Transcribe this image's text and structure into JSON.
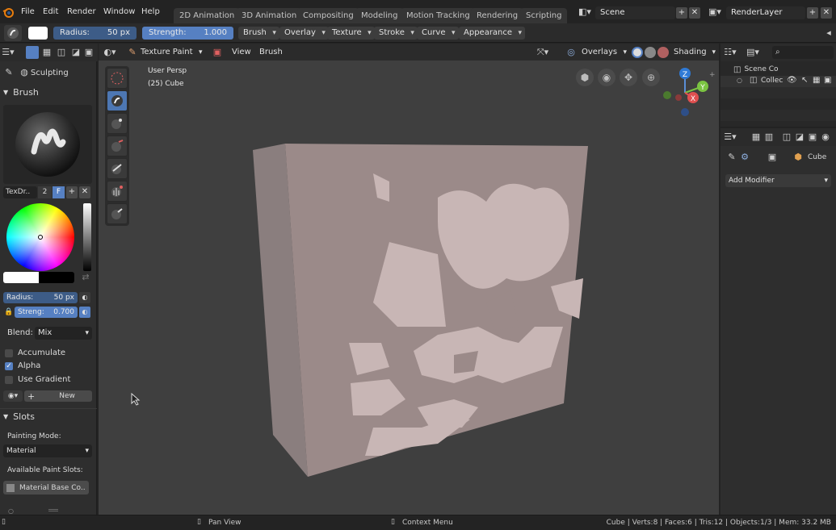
{
  "menubar": {
    "menus": [
      "File",
      "Edit",
      "Render",
      "Window",
      "Help"
    ],
    "workspaces": [
      "2D Animation",
      "3D Animation",
      "Compositing",
      "Modeling",
      "Motion Tracking",
      "Rendering",
      "Scripting"
    ],
    "scene_name": "Scene",
    "render_layer": "RenderLayer"
  },
  "toolheader": {
    "radius_label": "Radius:",
    "radius_value": "50 px",
    "strength_label": "Strength:",
    "strength_value": "1.000",
    "menus": [
      "Brush",
      "Overlay",
      "Texture",
      "Stroke",
      "Curve",
      "Appearance"
    ]
  },
  "left_header": {
    "mode_label": "Sculpting"
  },
  "brush_panel": {
    "title": "Brush",
    "brush_name": "TexDr..",
    "user_count": "2",
    "fake_user": "F",
    "radius_label": "Radius:",
    "radius_value": "50 px",
    "strength_label": "Streng:",
    "strength_value": "0.700",
    "blend_label": "Blend:",
    "blend_value": "Mix",
    "accumulate_label": "Accumulate",
    "alpha_label": "Alpha",
    "use_gradient_label": "Use Gradient",
    "new_label": "New"
  },
  "slots_panel": {
    "title": "Slots",
    "painting_mode_label": "Painting Mode:",
    "painting_mode_value": "Material",
    "available_label": "Available Paint Slots:",
    "slot_item": "Material Base Co.."
  },
  "viewport_header": {
    "mode": "Texture Paint",
    "view_label": "View",
    "brush_label": "Brush",
    "overlays_label": "Overlays",
    "shading_label": "Shading"
  },
  "viewport": {
    "view_name": "User Persp",
    "object_info": "(25) Cube",
    "gizmo_z": "Z",
    "gizmo_y": "Y",
    "gizmo_x": "X"
  },
  "outliner": {
    "scene_collection": "Scene Co",
    "collection": "Collec"
  },
  "properties": {
    "object_name": "Cube",
    "add_modifier": "Add Modifier"
  },
  "statusbar": {
    "pan_view": "Pan View",
    "context_menu": "Context Menu",
    "stats": "Cube | Verts:8 | Faces:6 | Tris:12 | Objects:1/3 | Mem: 33.2 MB"
  },
  "colors": {
    "accent_blue": "#4d77b3",
    "strength_blue": "#5680c2",
    "blender_orange": "#e87d0d",
    "cube_paint": "#c8b6b5",
    "cube_base": "#9b8a89"
  }
}
